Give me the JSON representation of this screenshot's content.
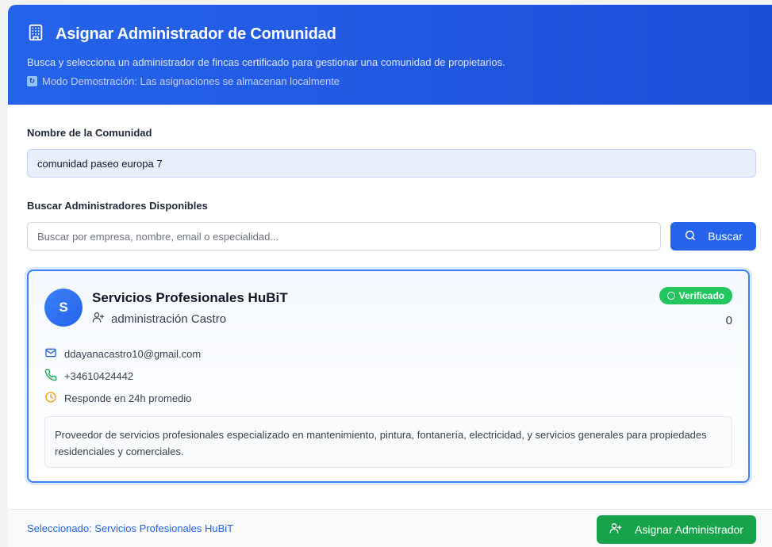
{
  "header": {
    "title": "Asignar Administrador de Comunidad",
    "description": "Busca y selecciona un administrador de fincas certificado para gestionar una comunidad de propietarios.",
    "demo_note": "Modo Demostración: Las asignaciones se almacenan localmente",
    "icon": "building-icon"
  },
  "form": {
    "community_label": "Nombre de la Comunidad",
    "community_value": "comunidad paseo europa 7",
    "search_label": "Buscar Administradores Disponibles",
    "search_placeholder": "Buscar por empresa, nombre, email o especialidad...",
    "search_button": "Buscar"
  },
  "administrator": {
    "avatar_letter": "S",
    "company": "Servicios Profesionales HuBiT",
    "contact_name": "administración Castro",
    "badge": "Verificado",
    "count": "0",
    "email": "ddayanacastro10@gmail.com",
    "phone": "+34610424442",
    "response_time": "Responde en 24h promedio",
    "description": "Proveedor de servicios profesionales especializado en mantenimiento, pintura, fontanería, electricidad, y servicios generales para propiedades residenciales y comerciales."
  },
  "footer": {
    "selected_text": "Seleccionado: Servicios Profesionales HuBiT",
    "assign_button": "Asignar Administrador"
  },
  "colors": {
    "primary": "#2563eb",
    "success": "#16a34a",
    "badge": "#22c55e"
  }
}
